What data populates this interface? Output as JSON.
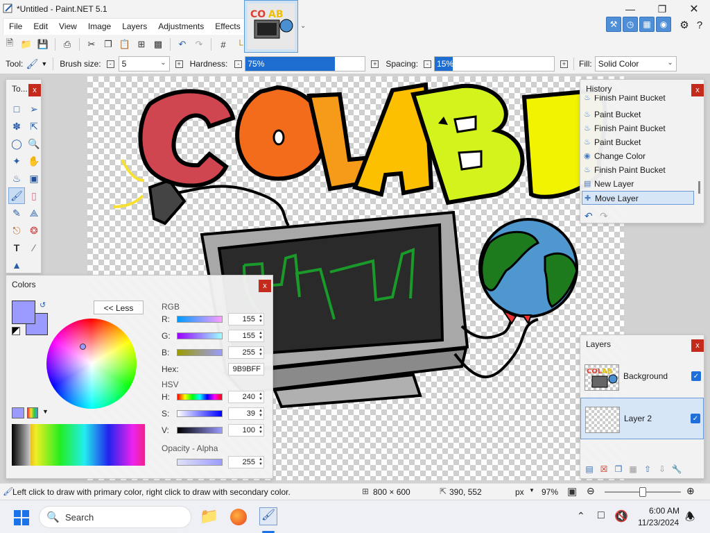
{
  "window": {
    "title": "*Untitled - Paint.NET 5.1"
  },
  "menu": [
    "File",
    "Edit",
    "View",
    "Image",
    "Layers",
    "Adjustments",
    "Effects"
  ],
  "options": {
    "tool_label": "Tool:",
    "brush_size_label": "Brush size:",
    "brush_size_value": "5",
    "hardness_label": "Hardness:",
    "hardness_value": "75%",
    "hardness_level": 0.75,
    "spacing_label": "Spacing:",
    "spacing_value": "15%",
    "spacing_level": 0.15,
    "fill_label": "Fill:",
    "fill_value": "Solid Color"
  },
  "tools_panel": {
    "title": "To...",
    "close": "x"
  },
  "history": {
    "title": "History",
    "close": "x",
    "items": [
      "Finish Paint Bucket",
      "Paint Bucket",
      "Finish Paint Bucket",
      "Paint Bucket",
      "Change Color",
      "Finish Paint Bucket",
      "New Layer",
      "Move Layer"
    ]
  },
  "layers": {
    "title": "Layers",
    "close": "x",
    "items": [
      {
        "name": "Background",
        "visible": true
      },
      {
        "name": "Layer 2",
        "visible": true
      }
    ]
  },
  "colors": {
    "title": "Colors",
    "close": "x",
    "less_button": "<< Less",
    "rgb_label": "RGB",
    "hsv_label": "HSV",
    "r_label": "R:",
    "r_value": "155",
    "g_label": "G:",
    "g_value": "155",
    "b_label": "B:",
    "b_value": "255",
    "hex_label": "Hex:",
    "hex_value": "9B9BFF",
    "h_label": "H:",
    "h_value": "240",
    "s_label": "S:",
    "s_value": "39",
    "v_label": "V:",
    "v_value": "100",
    "opacity_label": "Opacity - Alpha",
    "a_value": "255",
    "primary_color": "#9B9BFF",
    "secondary_color": "#9B9BFF"
  },
  "canvas_text": "COLAB",
  "status": {
    "hint": "Left click to draw with primary color, right click to draw with secondary color.",
    "image_size": "800 × 600",
    "cursor_pos": "390, 552",
    "units": "px",
    "zoom": "97%"
  },
  "taskbar": {
    "search_placeholder": "Search",
    "time": "6:00 AM",
    "date": "11/23/2024"
  }
}
